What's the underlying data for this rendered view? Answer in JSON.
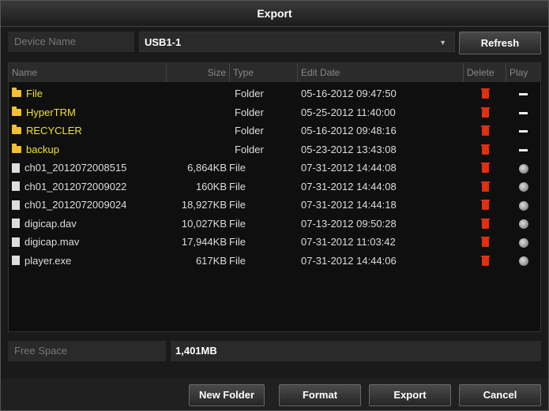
{
  "window": {
    "title": "Export"
  },
  "device": {
    "label": "Device Name",
    "value": "USB1-1",
    "refresh_label": "Refresh"
  },
  "table": {
    "headers": {
      "name": "Name",
      "size": "Size",
      "type": "Type",
      "date": "Edit Date",
      "delete": "Delete",
      "play": "Play"
    },
    "rows": [
      {
        "name": "File",
        "size": "",
        "type": "Folder",
        "date": "05-16-2012 09:47:50",
        "kind": "folder"
      },
      {
        "name": "HyperTRM",
        "size": "",
        "type": "Folder",
        "date": "05-25-2012 11:40:00",
        "kind": "folder"
      },
      {
        "name": "RECYCLER",
        "size": "",
        "type": "Folder",
        "date": "05-16-2012 09:48:16",
        "kind": "folder"
      },
      {
        "name": "backup",
        "size": "",
        "type": "Folder",
        "date": "05-23-2012 13:43:08",
        "kind": "folder"
      },
      {
        "name": "ch01_2012072008515",
        "size": "6,864KB",
        "type": "File",
        "date": "07-31-2012 14:44:08",
        "kind": "file"
      },
      {
        "name": "ch01_2012072009022",
        "size": "160KB",
        "type": "File",
        "date": "07-31-2012 14:44:08",
        "kind": "file"
      },
      {
        "name": "ch01_2012072009024",
        "size": "18,927KB",
        "type": "File",
        "date": "07-31-2012 14:44:18",
        "kind": "file"
      },
      {
        "name": "digicap.dav",
        "size": "10,027KB",
        "type": "File",
        "date": "07-13-2012 09:50:28",
        "kind": "file"
      },
      {
        "name": "digicap.mav",
        "size": "17,944KB",
        "type": "File",
        "date": "07-31-2012 11:03:42",
        "kind": "file"
      },
      {
        "name": "player.exe",
        "size": "617KB",
        "type": "File",
        "date": "07-31-2012 14:44:06",
        "kind": "file"
      }
    ]
  },
  "free_space": {
    "label": "Free Space",
    "value": "1,401MB"
  },
  "buttons": {
    "new_folder": "New Folder",
    "format": "Format",
    "export": "Export",
    "cancel": "Cancel"
  },
  "colors": {
    "folder_text": "#f0e030",
    "delete_icon": "#e03010",
    "background": "#1a1a1a"
  },
  "icons": {
    "folder": "folder-icon",
    "file": "file-icon",
    "delete": "trash-icon",
    "play": "play-icon",
    "no_play": "dash-icon",
    "dropdown": "chevron-down-icon"
  }
}
